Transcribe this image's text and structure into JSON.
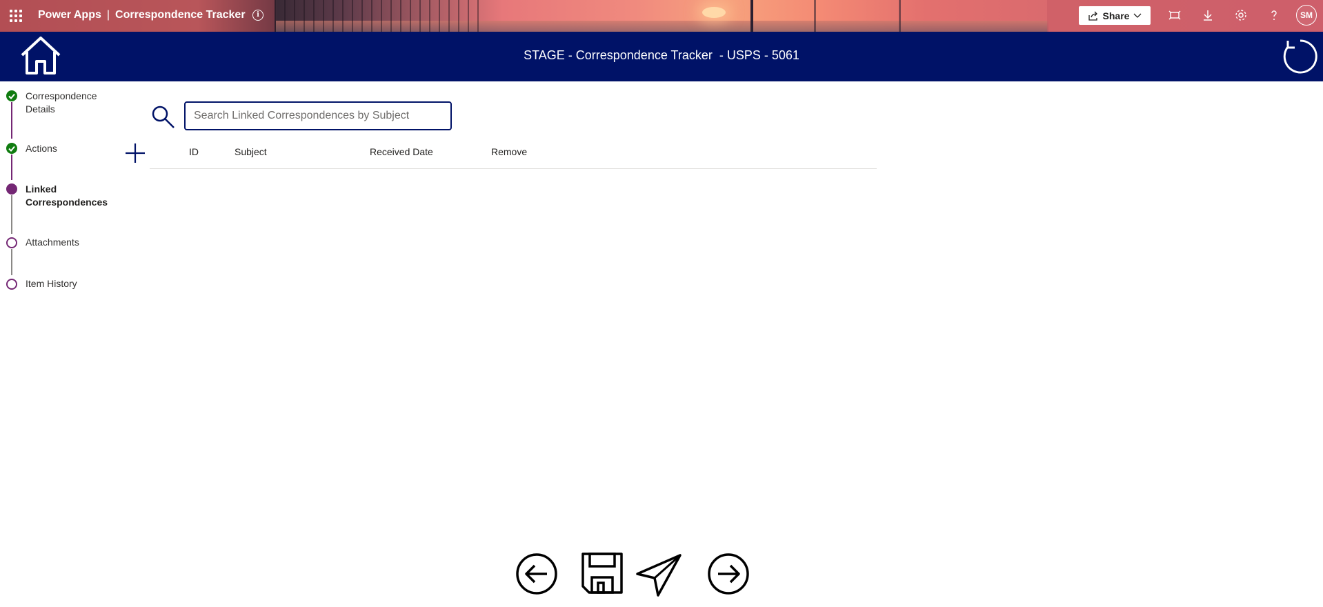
{
  "topbar": {
    "app_name": "Power Apps",
    "separator": "|",
    "app_title": "Correspondence Tracker",
    "share_label": "Share",
    "user_initials": "SM",
    "icons": [
      "waffle-icon",
      "info-icon",
      "share-icon",
      "chevron-down-icon",
      "fit-to-window-icon",
      "download-icon",
      "settings-icon",
      "help-icon"
    ]
  },
  "header": {
    "title": "STAGE - Correspondence Tracker  - USPS - 5061",
    "color": "#001267"
  },
  "stepper": {
    "colors": {
      "done": "#107c10",
      "current": "#742774",
      "todo_border": "#742774"
    },
    "steps": [
      {
        "label": "Correspondence Details",
        "status": "done"
      },
      {
        "label": "Actions",
        "status": "done"
      },
      {
        "label": "Linked Correspondences",
        "status": "current"
      },
      {
        "label": "Attachments",
        "status": "todo"
      },
      {
        "label": "Item History",
        "status": "todo"
      }
    ]
  },
  "search": {
    "placeholder": "Search Linked Correspondences by Subject",
    "value": ""
  },
  "table": {
    "columns": [
      "ID",
      "Subject",
      "Received Date",
      "Remove"
    ],
    "rows": []
  },
  "bottom_nav": [
    "back-arrow-icon",
    "save-icon",
    "send-icon",
    "forward-arrow-icon"
  ]
}
